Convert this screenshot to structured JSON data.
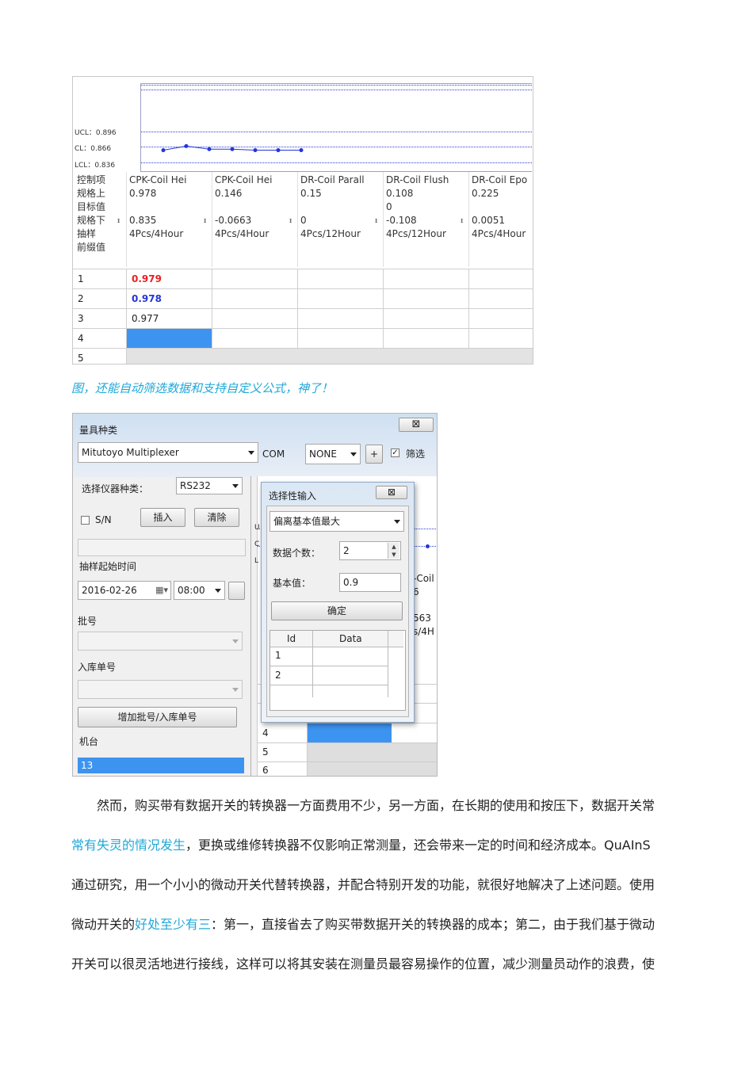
{
  "shot1": {
    "limits": {
      "ucl": "UCL：0.896",
      "cl": "CL：0.866",
      "lcl": "LCL：0.836"
    },
    "row_labels": [
      "控制项",
      "规格上",
      "目标值",
      "规格下",
      "抽样",
      "前缀值"
    ],
    "columns": [
      {
        "name": "CPK-Coil Hei",
        "usl": "0.978",
        "target": "",
        "lsl": "0.835",
        "sampling": "4Pcs/4Hour"
      },
      {
        "name": "CPK-Coil Hei",
        "usl": "0.146",
        "target": "",
        "lsl": "-0.0663",
        "sampling": "4Pcs/4Hour"
      },
      {
        "name": "DR-Coil Parall",
        "usl": "0.15",
        "target": "",
        "lsl": "0",
        "sampling": "4Pcs/12Hour"
      },
      {
        "name": "DR-Coil Flush",
        "usl": "0.108",
        "target": "0",
        "lsl": "-0.108",
        "sampling": "4Pcs/12Hour"
      },
      {
        "name": "DR-Coil Epo",
        "usl": "0.225",
        "target": "",
        "lsl": "0.0051",
        "sampling": "4Pcs/4Hour"
      }
    ],
    "rows": [
      {
        "id": "1",
        "value": "0.979",
        "color": "#e8201f"
      },
      {
        "id": "2",
        "value": "0.978",
        "color": "#2436d8"
      },
      {
        "id": "3",
        "value": "0.977",
        "color": "#222222"
      },
      {
        "id": "4",
        "value": "",
        "color": "#222222"
      },
      {
        "id": "5",
        "value": "",
        "color": "#222222"
      }
    ],
    "selected_cell_color": "#3d93f0",
    "chart_points": [
      0.859,
      0.867,
      0.861,
      0.861,
      0.859,
      0.859,
      0.859
    ]
  },
  "caption": "图，还能自动筛选数据和支持自定义公式，神了！",
  "shot2": {
    "title": "量具种类",
    "gauge_select": "Mitutoyo Multiplexer",
    "com_label": "COM",
    "com_select": "NONE",
    "plus_button": "+",
    "filter_label": "筛选",
    "instrument_label": "选择仪器种类：",
    "instrument_select": "RS232",
    "sn_label": "S/N",
    "insert_button": "插入",
    "clear_button": "清除",
    "start_time_label": "抽样起始时间",
    "date_value": "2016-02-26",
    "time_value": "08:00",
    "batch_label": "批号",
    "inbound_label": "入库单号",
    "add_batch_button": "增加批号/入库单号",
    "machine_label": "机台",
    "machine_value": "13",
    "bg_labels": {
      "u": "U",
      "c": "C",
      "l": "L",
      "coil": "-Coil",
      "six": "6",
      "n563": "563",
      "s4h": "s/4H"
    },
    "bg_rows": [
      "4",
      "5",
      "6"
    ],
    "dialog": {
      "title": "选择性输入",
      "mode_select": "偏离基本值最大",
      "count_label": "数据个数：",
      "count_value": "2",
      "base_label": "基本值：",
      "base_value": "0.9",
      "ok_button": "确定",
      "table_headers": [
        "Id",
        "Data"
      ],
      "table_rows": [
        {
          "id": "1",
          "data": ""
        },
        {
          "id": "2",
          "data": ""
        }
      ]
    }
  },
  "paragraph": {
    "line1": "然而，购买带有数据开关的转换器一方面费用不少，另一方面，在长期的使用和按压下，数据开关常",
    "line2_hl": "常有失灵的情况发生",
    "line2_rest": "，更换或维修转换器不仅影响正常测量，还会带来一定的时间和经济成本。QuAInS",
    "line3": "通过研究，用一个小小的微动开关代替转换器，并配合特别开发的功能，就很好地解决了上述问题。使用",
    "line4_a": "微动开关的",
    "line4_hl": "好处至少有三",
    "line4_b": "：第一，直接省去了购买带数据开关的转换器的成本；第二，由于我们基于微动",
    "line5": "开关可以很灵活地进行接线，这样可以将其安装在测量员最容易操作的位置，减少测量员动作的浪费，使"
  }
}
